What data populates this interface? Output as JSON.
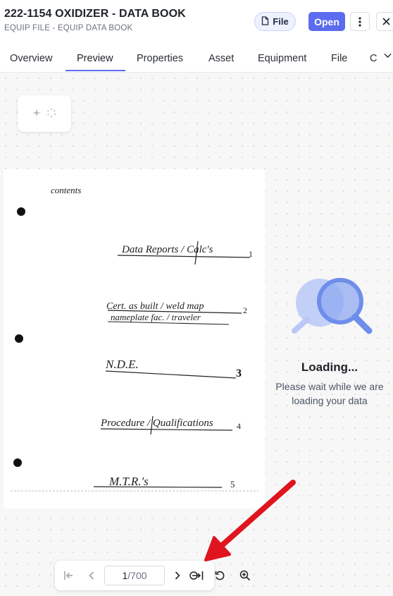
{
  "header": {
    "title": "222-1154 OXIDIZER - DATA BOOK",
    "subtitle": "EQUIP FILE - EQUIP DATA BOOK",
    "file_button": "File",
    "open_button": "Open",
    "more_icon": "more-vertical-icon",
    "close_icon": "close-icon"
  },
  "tabs": [
    {
      "label": "Overview",
      "active": false
    },
    {
      "label": "Preview",
      "active": true
    },
    {
      "label": "Properties",
      "active": false
    },
    {
      "label": "Asset",
      "active": false
    },
    {
      "label": "Equipment",
      "active": false
    },
    {
      "label": "File",
      "active": false
    },
    {
      "label": "C",
      "active": false
    }
  ],
  "document": {
    "heading": "contents",
    "entries": [
      {
        "text": "Data Reports / Calc's",
        "number": "1"
      },
      {
        "text": "Cert. as built / weld map",
        "text2": "nameplate fac. / traveler",
        "number": "2"
      },
      {
        "text": "N.D.E.",
        "number": "3"
      },
      {
        "text": "Procedure / Qualifications",
        "number": "4"
      },
      {
        "text": "M.T.R.'s",
        "number": "5"
      }
    ]
  },
  "loading": {
    "title": "Loading...",
    "message": "Please wait while we are loading your data"
  },
  "pager": {
    "current_page": "1",
    "separator": "/",
    "total_pages": "700"
  },
  "colors": {
    "accent": "#5b6cf0",
    "annotation_arrow": "#e0141e"
  }
}
